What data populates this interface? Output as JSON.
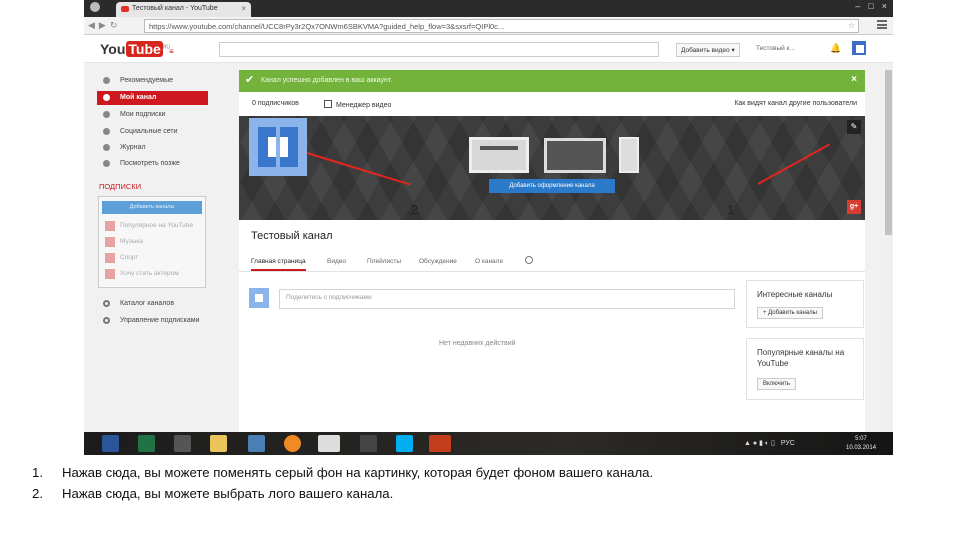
{
  "browser": {
    "tab_title": "Тестовый канал - YouTube",
    "tab_close": "×",
    "address": "https://www.youtube.com/channel/UCC8rPy3r2Qx7ONWm6SBKVMA?guided_help_flow=3&sxsrf=QIPl0c...",
    "window_controls": [
      "–",
      "□",
      "×"
    ]
  },
  "youtube_header": {
    "logo_you": "You",
    "logo_tube": "Tube",
    "logo_region": "RU",
    "guide_label": "≡",
    "search_button": "⌕",
    "upload_label": "Добавить видео",
    "upload_dropdown": "▾",
    "account_name": "Тестовый к...",
    "bell": "🔔"
  },
  "guide": {
    "items": [
      {
        "label": "Рекомендуемые",
        "icon": "home-icon"
      },
      {
        "label": "Мой канал",
        "icon": "channel-icon",
        "active": true
      },
      {
        "label": "Мои подписки",
        "icon": "subscriptions-icon"
      },
      {
        "label": "Социальные сети",
        "icon": "social-icon"
      },
      {
        "label": "Журнал",
        "icon": "history-icon"
      },
      {
        "label": "Посмотреть позже",
        "icon": "watch-later-icon"
      }
    ],
    "subs_section": "ПОДПИСКИ",
    "subs_button": "Добавить каналы",
    "recommended": [
      "Популярное на YouTube",
      "Музыка",
      "Спорт",
      "Хочу стать актером"
    ],
    "bottom": [
      {
        "label": "Каталог каналов",
        "icon": "catalog-icon"
      },
      {
        "label": "Управление подписками",
        "icon": "manage-icon"
      }
    ]
  },
  "main": {
    "notice_text": "Канал успешно добавлен в ваш аккаунт.",
    "notice_check": "✔",
    "notice_close": "×",
    "subscribers": "0 подписчиков",
    "videos_manager": "Менеджер видео",
    "view_as": "Как видят канал другие пользователи",
    "add_art_button": "Добавить оформление канала",
    "edit_icon": "✎",
    "gplus": "g+",
    "annotation_2": "2",
    "annotation_1": "1",
    "channel_title": "Тестовый канал",
    "tabs": [
      "Главная страница",
      "Видео",
      "Плейлисты",
      "Обсуждение",
      "О канале"
    ],
    "share_placeholder": "Поделитесь с подписчиками",
    "no_activity": "Нет недавних действий",
    "featured_title": "Интересные каналы",
    "featured_button": "+ Добавить каналы",
    "popular_title": "Популярные каналы на YouTube",
    "popular_button": "Включить"
  },
  "taskbar": {
    "apps": [
      "word-icon",
      "excel-icon",
      "apps-icon",
      "explorer-icon",
      "network-icon",
      "avast-icon",
      "chrome-icon",
      "inkscape-icon",
      "skype-icon",
      "powerpoint-icon"
    ],
    "tray_up": "▲",
    "lang": "РУС",
    "time": "5:07",
    "date": "10.03.2014"
  },
  "caption": {
    "items": [
      {
        "n": "1.",
        "text": "Нажав сюда, вы можете поменять серый фон на картинку, которая будет фоном вашего канала."
      },
      {
        "n": "2.",
        "text": "Нажав сюда, вы можете выбрать лого вашего канала."
      }
    ]
  },
  "colors": {
    "youtube_red": "#cc181e",
    "notice_green": "#73b33c",
    "button_blue": "#2b7ac9",
    "annotation_red": "#e2251f"
  }
}
